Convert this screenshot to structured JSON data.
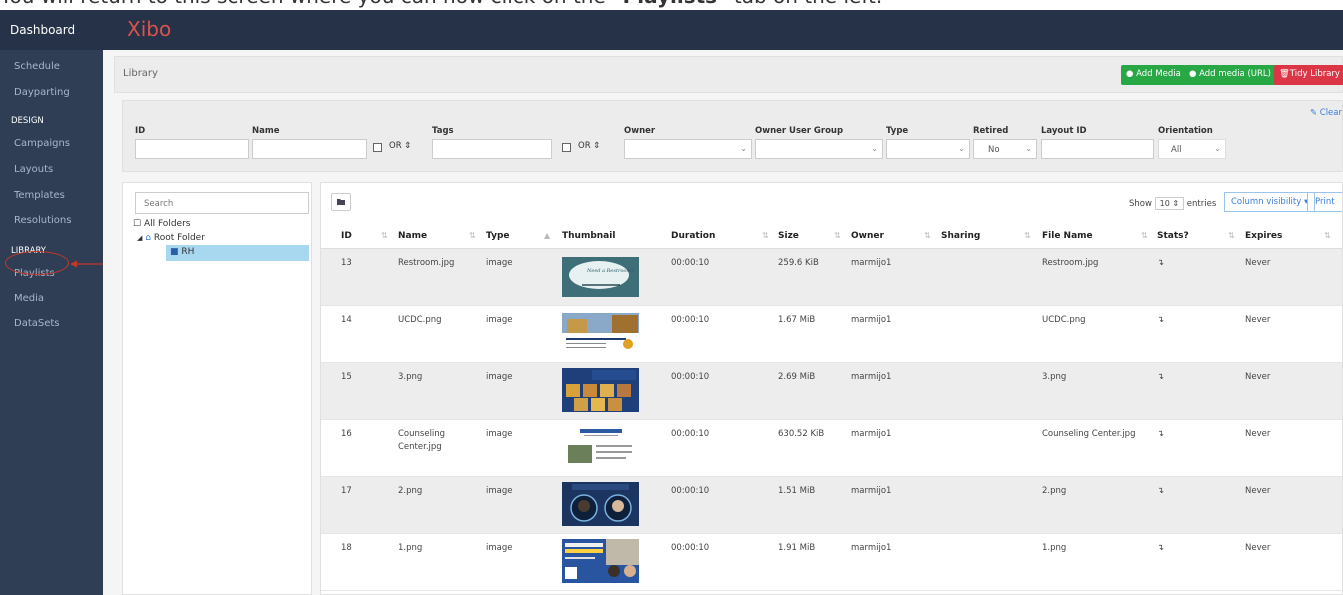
{
  "caption": {
    "prefix": "You will return to this screen where you can now click on the ",
    "bold": "\"Playlists\"",
    "suffix": " tab on the left."
  },
  "nav": {
    "dashboard": "Dashboard",
    "logo": "Xibo",
    "items": {
      "schedule": "Schedule",
      "dayparting": "Dayparting",
      "design_head": "DESIGN",
      "campaigns": "Campaigns",
      "layouts": "Layouts",
      "templates": "Templates",
      "resolutions": "Resolutions",
      "library_head": "LIBRARY",
      "playlists": "Playlists",
      "media": "Media",
      "datasets": "DataSets"
    }
  },
  "library": {
    "title": "Library",
    "add_media": "Add Media",
    "add_media_url": "Add media (URL)",
    "tidy_library": "Tidy Library"
  },
  "filter": {
    "clear": "Clear",
    "labels": {
      "id": "ID",
      "name": "Name",
      "tags": "Tags",
      "owner": "Owner",
      "owner_group": "Owner User Group",
      "type": "Type",
      "retired": "Retired",
      "layout_id": "Layout ID",
      "orientation": "Orientation"
    },
    "or": "OR",
    "retired_value": "No",
    "orientation_value": "All"
  },
  "tree": {
    "search_placeholder": "Search",
    "all_folders": "All Folders",
    "root": "Root Folder",
    "rh": "RH"
  },
  "table": {
    "show": "Show",
    "entries_count": "10",
    "entries": "entries",
    "column_visibility": "Column visibility",
    "print": "Print",
    "headers": {
      "id": "ID",
      "name": "Name",
      "type": "Type",
      "thumbnail": "Thumbnail",
      "duration": "Duration",
      "size": "Size",
      "owner": "Owner",
      "sharing": "Sharing",
      "file_name": "File Name",
      "stats": "Stats?",
      "expires": "Expires"
    },
    "rows": [
      {
        "id": "13",
        "name": "Restroom.jpg",
        "name2": "",
        "type": "image",
        "duration": "00:00:10",
        "size": "259.6 KiB",
        "owner": "marmijo1",
        "file": "Restroom.jpg",
        "stats": "↴",
        "expires": "Never"
      },
      {
        "id": "14",
        "name": "UCDC.png",
        "name2": "",
        "type": "image",
        "duration": "00:00:10",
        "size": "1.67 MiB",
        "owner": "marmijo1",
        "file": "UCDC.png",
        "stats": "↴",
        "expires": "Never"
      },
      {
        "id": "15",
        "name": "3.png",
        "name2": "",
        "type": "image",
        "duration": "00:00:10",
        "size": "2.69 MiB",
        "owner": "marmijo1",
        "file": "3.png",
        "stats": "↴",
        "expires": "Never"
      },
      {
        "id": "16",
        "name": "Counseling",
        "name2": "Center.jpg",
        "type": "image",
        "duration": "00:00:10",
        "size": "630.52 KiB",
        "owner": "marmijo1",
        "file": "Counseling Center.jpg",
        "stats": "↴",
        "expires": "Never"
      },
      {
        "id": "17",
        "name": "2.png",
        "name2": "",
        "type": "image",
        "duration": "00:00:10",
        "size": "1.51 MiB",
        "owner": "marmijo1",
        "file": "2.png",
        "stats": "↴",
        "expires": "Never"
      },
      {
        "id": "18",
        "name": "1.png",
        "name2": "",
        "type": "image",
        "duration": "00:00:10",
        "size": "1.91 MiB",
        "owner": "marmijo1",
        "file": "1.png",
        "stats": "↴",
        "expires": "Never"
      }
    ]
  },
  "colors": {
    "sidebar": "#2f3e55",
    "topbar": "#253247",
    "green": "#28a745",
    "red": "#dc3545",
    "selected": "#a8d8f0"
  }
}
